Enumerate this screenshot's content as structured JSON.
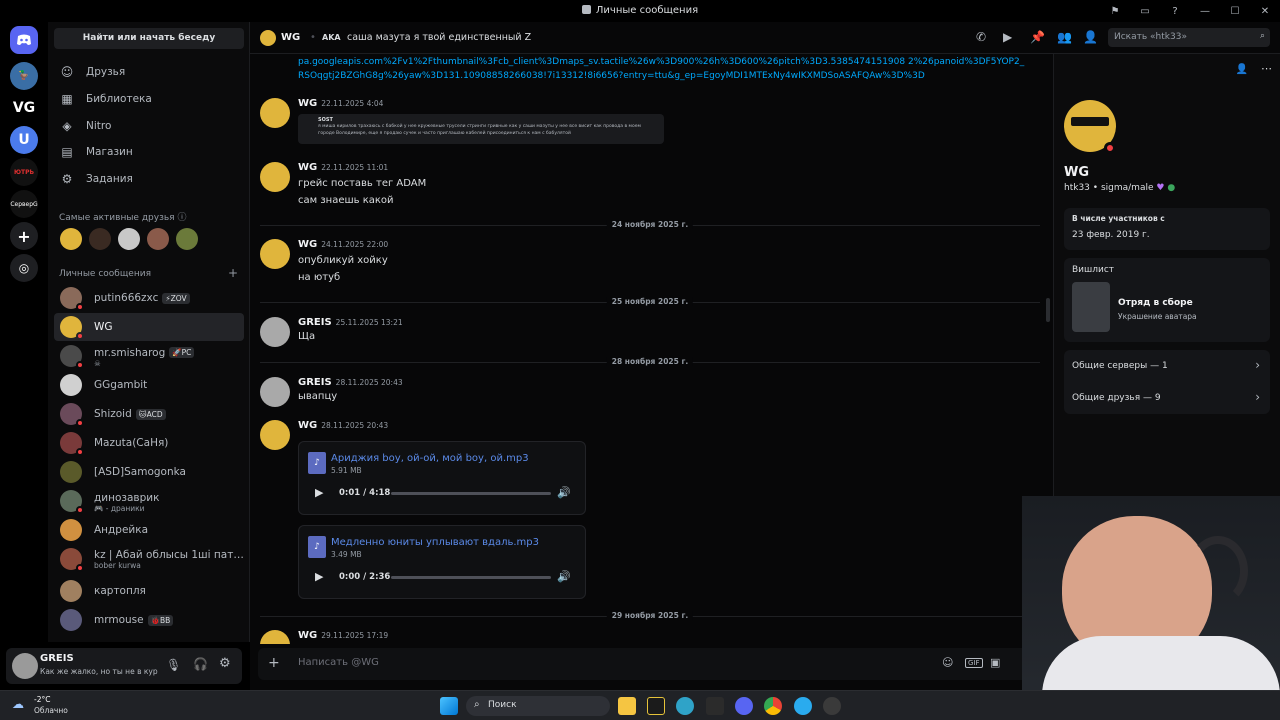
{
  "window": {
    "title": "Личные сообщения"
  },
  "sidebar": {
    "search_label": "Найти или начать беседу",
    "nav": [
      {
        "label": "Друзья",
        "icon": "friends-icon"
      },
      {
        "label": "Библиотека",
        "icon": "library-icon"
      },
      {
        "label": "Nitro",
        "icon": "nitro-icon"
      },
      {
        "label": "Магазин",
        "icon": "shop-icon"
      },
      {
        "label": "Задания",
        "icon": "quests-icon"
      }
    ],
    "active_friends_title": "Самые активные друзья",
    "dm_title": "Личные сообщения",
    "dms": [
      {
        "name": "putin666zxc",
        "tag": "⚡ZOV",
        "sub": ""
      },
      {
        "name": "WG",
        "tag": "",
        "sub": ""
      },
      {
        "name": "mr.smisharog",
        "tag": "🚀PC",
        "sub": "☠"
      },
      {
        "name": "GGgambit",
        "tag": "",
        "sub": ""
      },
      {
        "name": "Shizoid",
        "tag": "🐱ACD",
        "sub": ""
      },
      {
        "name": "Mazuta(СаНя)",
        "tag": "",
        "sub": ""
      },
      {
        "name": "[ASD]Samogonka",
        "tag": "",
        "sub": ""
      },
      {
        "name": "динозаврик",
        "tag": "",
        "sub": "🎮 - дрaники"
      },
      {
        "name": "Андрейка",
        "tag": "",
        "sub": ""
      },
      {
        "name": "kz | Абай облысы 1ші патрио...",
        "tag": "",
        "sub": "bober kurwa"
      },
      {
        "name": "картопля",
        "tag": "",
        "sub": ""
      },
      {
        "name": "mrmouse",
        "tag": "🐞BB",
        "sub": ""
      }
    ]
  },
  "userbar": {
    "name": "GREIS",
    "status": "Как же жалко, но ты не в курс..."
  },
  "header": {
    "name": "WG",
    "aka_label": "AKA",
    "aka": "саша мазута я твой единственный Z",
    "search_placeholder": "Искать «htk33»"
  },
  "chat": {
    "link_text": "pa.googleapis.com%2Fv1%2Fthumbnail%3Fcb_client%3Dmaps_sv.tactile%26w%3D900%26h%3D600%26pitch%3D3.5385474151908 2%26panoid%3DF5YOP2_RSOqgtj2BZGhG8g%26yaw%3D131.10908858266038!7i13312!8i6656?entry=ttu&g_ep=EgoyMDI1MTExNy4wIKXMDSoASAFQAw%3D%3D",
    "msg1": {
      "author": "WG",
      "time": "22.11.2025 4:04"
    },
    "embed": {
      "author": "SOST",
      "text1": "я миша кирилов трахаюсь с бабкой у нее кружевные трусели стринги гривные как у саши мазуты у нее все висит как провода в моем",
      "text2": "городе Володимире, еще я продаю сучек и часто приглашаю кабелей присоединиться к нам с бабулятой"
    },
    "msg2": {
      "author": "WG",
      "time": "22.11.2025 11:01",
      "lines": [
        "грейс поставь тег ADAM",
        "сам знаешь какой"
      ]
    },
    "date1": "24 ноября 2025 г.",
    "msg3": {
      "author": "WG",
      "time": "24.11.2025 22:00",
      "lines": [
        "опубликуй хойку",
        "на ютуб"
      ]
    },
    "date2": "25 ноября 2025 г.",
    "msg4": {
      "author": "GREIS",
      "time": "25.11.2025 13:21",
      "lines": [
        "Ща"
      ]
    },
    "date3": "28 ноября 2025 г.",
    "msg5": {
      "author": "GREIS",
      "time": "28.11.2025 20:43",
      "lines": [
        "ывапцу"
      ]
    },
    "msg6": {
      "author": "WG",
      "time": "28.11.2025 20:43"
    },
    "audio1": {
      "name": "Ариджия boy, ой-ой, мой boy, ой.mp3",
      "size": "5.91 MB",
      "time": "0:01 / 4:18",
      "progress": 0.0
    },
    "audio2": {
      "name": "Медленно юниты уплывают вдаль.mp3",
      "size": "3.49 MB",
      "time": "0:00 / 2:36",
      "progress": 0.0
    },
    "date4": "29 ноября 2025 г.",
    "msg7": {
      "author": "WG",
      "time": "29.11.2025 17:19"
    },
    "composer_placeholder": "Написать @WG"
  },
  "profile": {
    "name": "WG",
    "handle": "htk33",
    "sep": "•",
    "pronouns": "sigma/male",
    "member_since_label": "В числе участников с",
    "member_since": "23 февр. 2019 г.",
    "wishlist_label": "Вишлист",
    "wishlist_item": "Отряд в сборе",
    "wishlist_sub": "Украшение аватара",
    "common_servers": "Общие серверы — 1",
    "common_friends": "Общие друзья — 9"
  },
  "taskbar": {
    "weather_temp": "-2°C",
    "weather_desc": "Облачно",
    "search": "Поиск"
  },
  "servers": [
    {
      "label": "СерверG"
    }
  ]
}
